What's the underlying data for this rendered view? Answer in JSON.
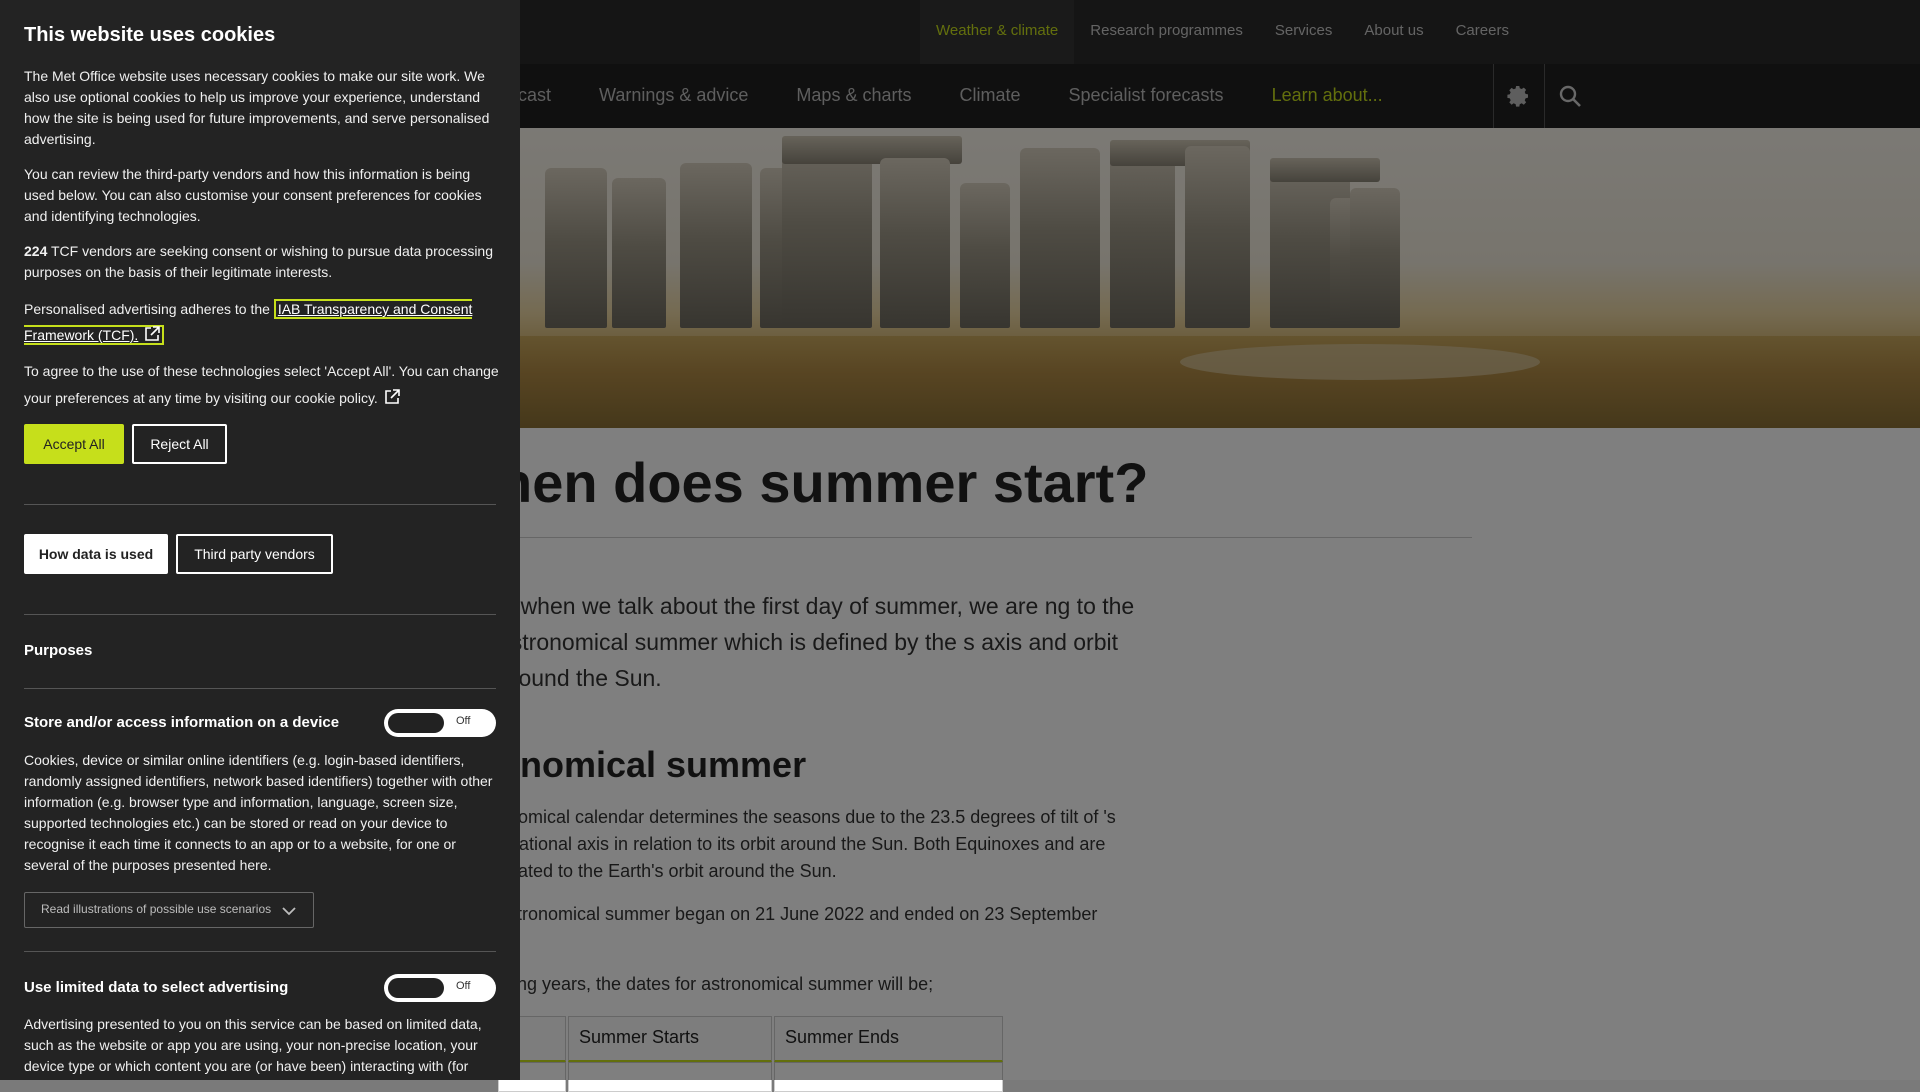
{
  "top_nav": {
    "items": [
      "Weather & climate",
      "Research programmes",
      "Services",
      "About us",
      "Careers"
    ],
    "active": "Weather & climate"
  },
  "main_nav": {
    "items": [
      "cast",
      "Warnings & advice",
      "Maps & charts",
      "Climate",
      "Specialist forecasts",
      "Learn about..."
    ]
  },
  "article": {
    "title": "hen does summer start?",
    "lead": "y, when we talk about the first day of summer, we are ng to the astronomical summer which is defined by the s axis and orbit around the Sun.",
    "subheading": "onomical summer",
    "para1": "onomical calendar determines the seasons due to the 23.5 degrees of tilt of 's rotational axis in relation to its orbit around the Sun. Both Equinoxes and are related to the Earth's orbit around the Sun.",
    "para2": "astronomical summer began on 21 June 2022 and ended on 23 September",
    "para3": "ming years, the dates for astronomical summer will be;",
    "table_headers": [
      "",
      "Summer Starts",
      "Summer Ends"
    ]
  },
  "cookie": {
    "title": "This website uses cookies",
    "p1": "The Met Office website uses necessary cookies to make our site work. We also use optional cookies to help us improve your experience, understand how the site is being used for future improvements, and serve personalised advertising.",
    "p2": "You can review the third-party vendors and how this information is being used below. You can also customise your consent preferences for cookies and identifying technologies.",
    "vendor_count": "224",
    "p3_rest": " TCF vendors are seeking consent or wishing to pursue data processing purposes on the basis of their legitimate interests.",
    "p4_prefix": "Personalised advertising adheres to the ",
    "tcf_link": "IAB Transparency and Consent Framework (TCF).",
    "p5": "To agree to the use of these technologies select 'Accept All'. You can change your preferences at any time by visiting our cookie policy.",
    "accept_label": "Accept All",
    "reject_label": "Reject All",
    "how_label": "How data is used",
    "vendors_label": "Third party vendors",
    "purposes_heading": "Purposes",
    "purpose1": {
      "title": "Store and/or access information on a device",
      "toggle": "Off",
      "desc": "Cookies, device or similar online identifiers (e.g. login-based identifiers, randomly assigned identifiers, network based identifiers) together with other information (e.g. browser type and information, language, screen size, supported technologies etc.) can be stored or read on your device to recognise it each time it connects to an app or to a website, for one or several of the purposes presented here.",
      "dropdown": "Read illustrations of possible use scenarios"
    },
    "purpose2": {
      "title": "Use limited data to select advertising",
      "toggle": "Off",
      "desc": "Advertising presented to you on this service can be based on limited data, such as the website or app you are using, your non-precise location, your device type or which content you are (or have been) interacting with (for"
    }
  },
  "colors": {
    "accent": "#c6df1b",
    "panel": "#232323",
    "nav": "#202020"
  }
}
